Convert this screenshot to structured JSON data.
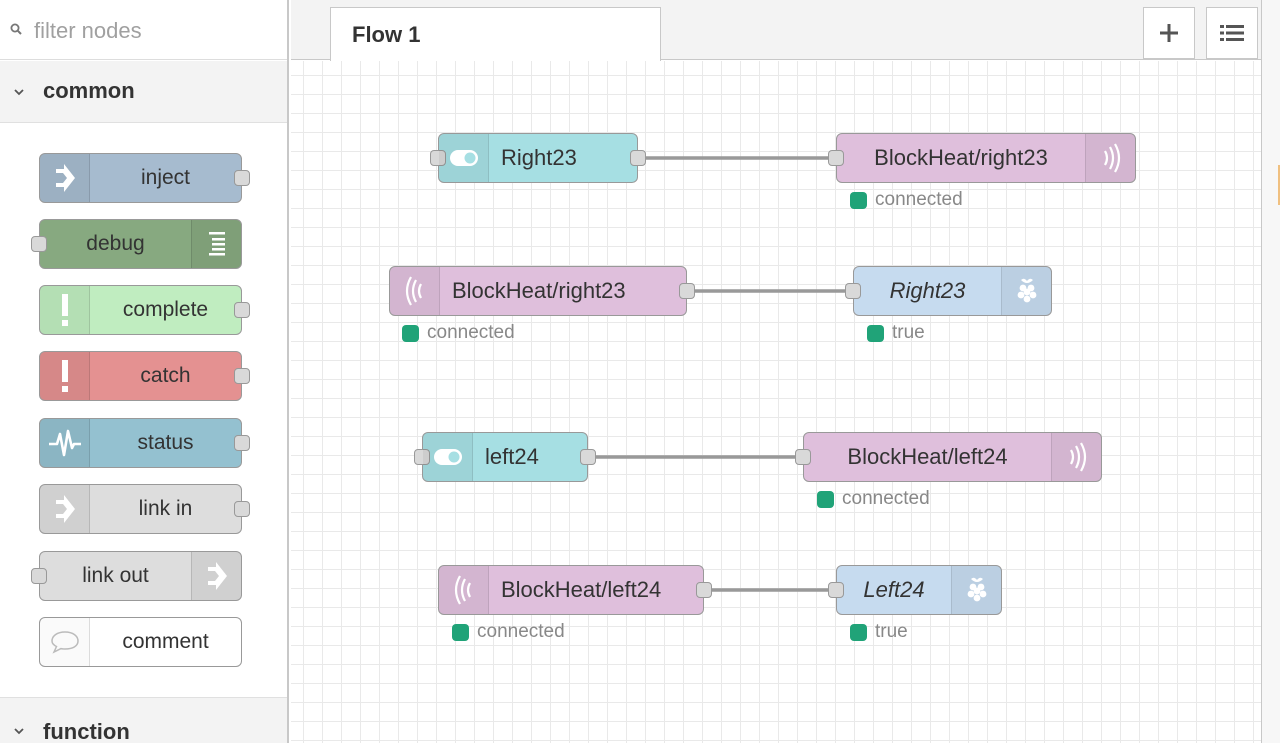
{
  "palette": {
    "filter_placeholder": "filter nodes",
    "categories": [
      {
        "label": "common",
        "nodes": [
          {
            "label": "inject",
            "color": "#a6bbcf",
            "icon": "inject-arrow-icon"
          },
          {
            "label": "debug",
            "color": "#87a980",
            "icon": "debug-list-icon"
          },
          {
            "label": "complete",
            "color": "#c0edc0",
            "icon": "exclamation-icon"
          },
          {
            "label": "catch",
            "color": "#e49191",
            "icon": "exclamation-icon"
          },
          {
            "label": "status",
            "color": "#94c1d0",
            "icon": "status-pulse-icon"
          },
          {
            "label": "link in",
            "color": "#dddddd",
            "icon": "link-in-icon"
          },
          {
            "label": "link out",
            "color": "#dddddd",
            "icon": "link-out-icon"
          },
          {
            "label": "comment",
            "color": "#ffffff",
            "icon": "comment-bubble-icon"
          }
        ]
      },
      {
        "label": "function"
      }
    ]
  },
  "workspace": {
    "tabs": [
      {
        "label": "Flow 1"
      }
    ],
    "add_tab_icon": "plus-icon",
    "menu_icon": "list-menu-icon"
  },
  "flow": {
    "colors": {
      "switch": "#a6dfe3",
      "mqtt": "#dfbfdc",
      "gpio": "#c6dbef",
      "status_dot": "#20a378"
    },
    "rows": [
      {
        "source": {
          "label": "Right23",
          "type": "switch",
          "icon": "toggle-switch-icon"
        },
        "target": {
          "label": "BlockHeat/right23",
          "type": "mqtt out",
          "icon": "mqtt-wave-icon",
          "status": "connected"
        }
      },
      {
        "source": {
          "label": "BlockHeat/right23",
          "type": "mqtt in",
          "icon": "mqtt-wave-icon",
          "status": "connected"
        },
        "target": {
          "label": "Right23",
          "type": "rpi gpio",
          "icon": "raspberry-icon",
          "status": "true"
        }
      },
      {
        "source": {
          "label": "left24",
          "type": "switch",
          "icon": "toggle-switch-icon"
        },
        "target": {
          "label": "BlockHeat/left24",
          "type": "mqtt out",
          "icon": "mqtt-wave-icon",
          "status": "connected"
        }
      },
      {
        "source": {
          "label": "BlockHeat/left24",
          "type": "mqtt in",
          "icon": "mqtt-wave-icon",
          "status": "connected"
        },
        "target": {
          "label": "Left24",
          "type": "rpi gpio",
          "icon": "raspberry-icon",
          "status": "true"
        }
      }
    ]
  }
}
